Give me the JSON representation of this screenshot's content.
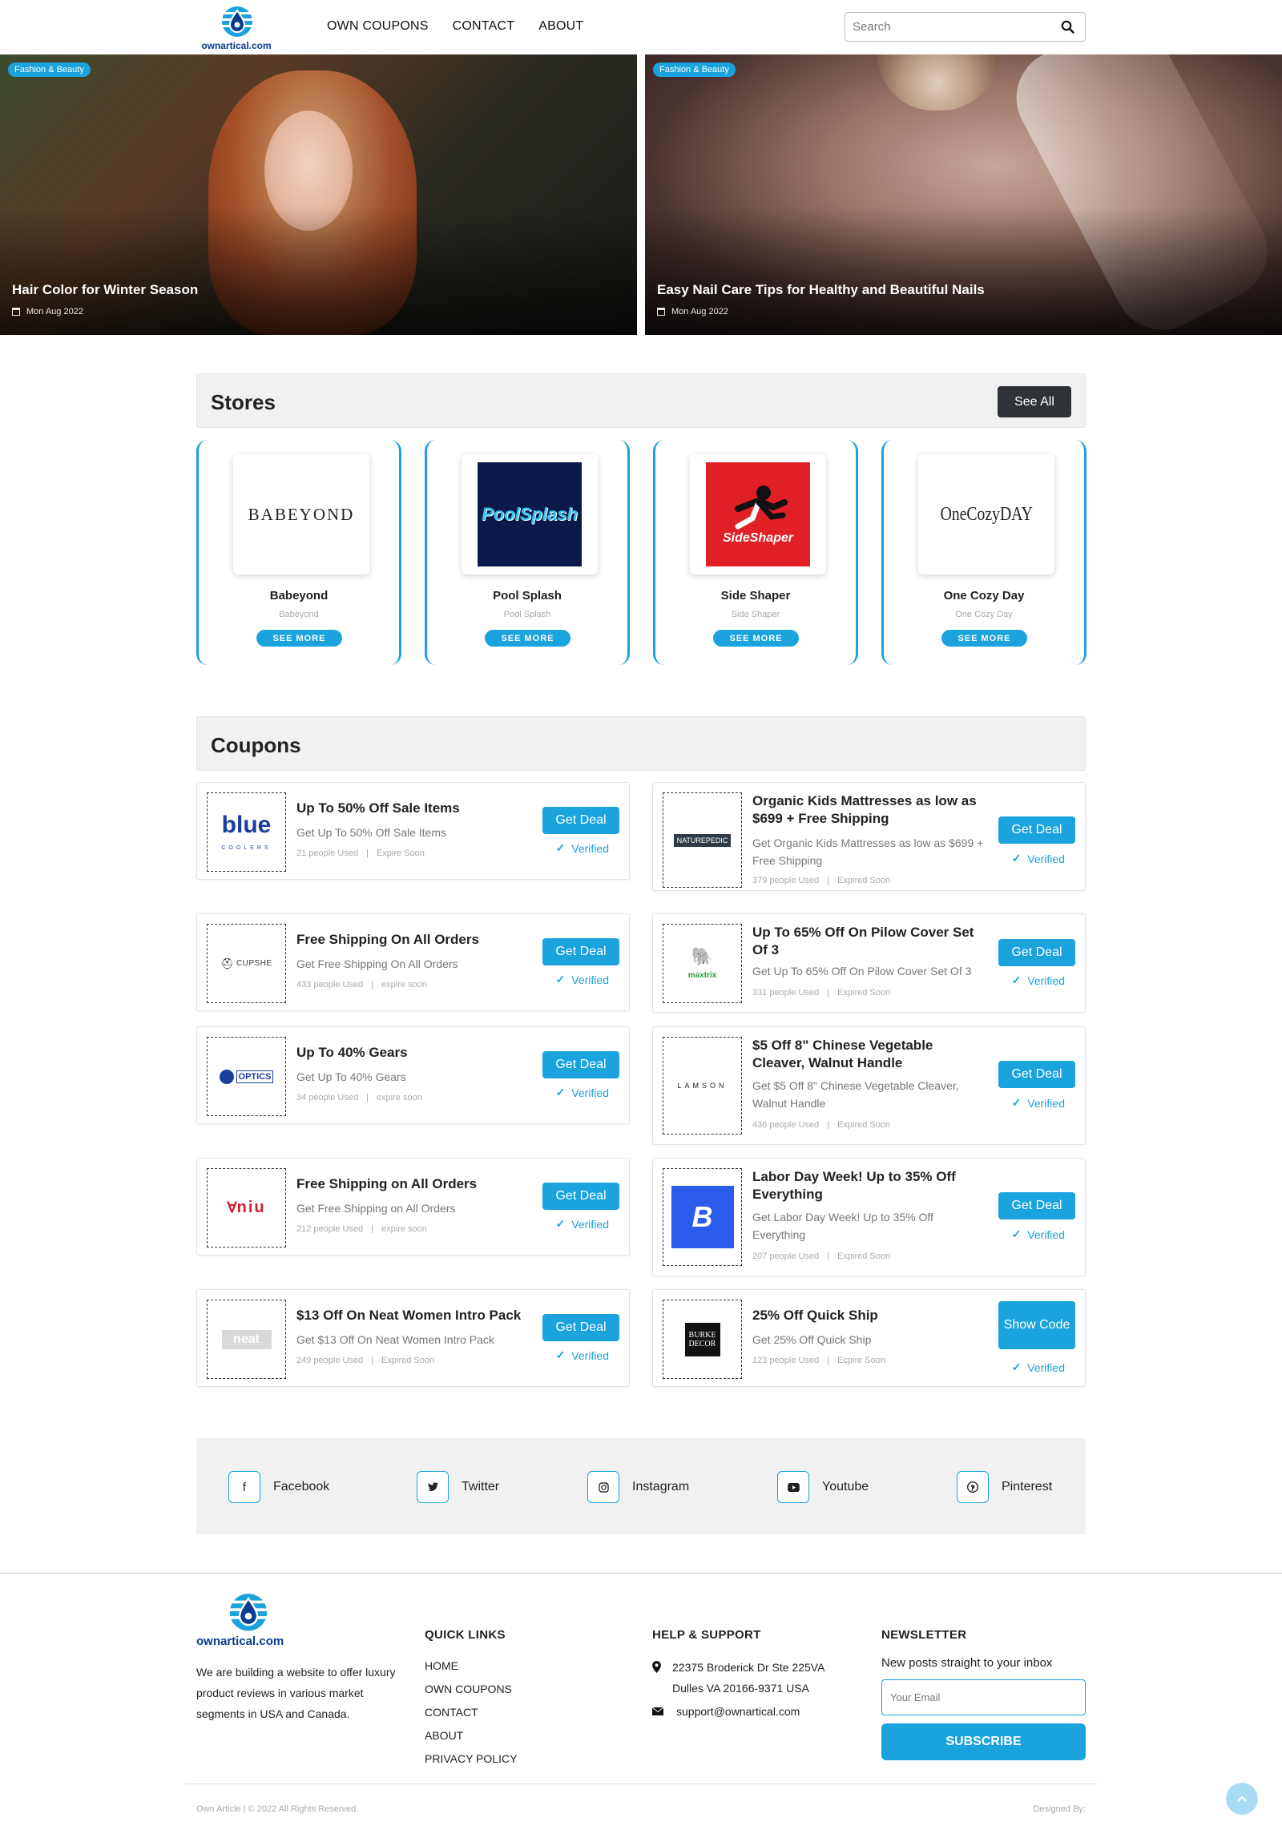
{
  "header": {
    "logo_text": "ownartical.com",
    "nav": [
      "OWN COUPONS",
      "CONTACT",
      "ABOUT"
    ],
    "search_placeholder": "Search"
  },
  "hero": [
    {
      "tag": "Fashion & Beauty",
      "title": "Hair Color for Winter Season",
      "date": "Mon Aug 2022"
    },
    {
      "tag": "Fashion & Beauty",
      "title": "Easy Nail Care Tips for Healthy and Beautiful Nails",
      "date": "Mon Aug 2022"
    }
  ],
  "stores": {
    "title": "Stores",
    "see_all": "See All",
    "items": [
      {
        "logo": "BABEYOND",
        "name": "Babeyond",
        "sub": "Babeyond",
        "button": "SEE MORE"
      },
      {
        "logo": "PoolSplash",
        "name": "Pool Splash",
        "sub": "Pool Splash",
        "button": "SEE MORE"
      },
      {
        "logo": "SideShaper",
        "name": "Side Shaper",
        "sub": "Side Shaper",
        "button": "SEE MORE"
      },
      {
        "logo": "OneCozyDAY",
        "name": "One Cozy Day",
        "sub": "One Cozy Day",
        "button": "SEE MORE"
      }
    ]
  },
  "coupons": {
    "title": "Coupons",
    "items": [
      {
        "logo": "blue",
        "logo_sub": "COOLERS",
        "title": "Up To 50% Off Sale Items",
        "desc": "Get Up To 50% Off Sale Items",
        "used": "21 people Used",
        "expire": "Expire Soon",
        "button": "Get Deal",
        "verified": "Verified"
      },
      {
        "logo": "NATUREPEDIC",
        "title": "Organic Kids Mattresses as low as $699 + Free Shipping",
        "desc": "Get Organic Kids Mattresses as low as $699 + Free Shipping",
        "used": "379 people Used",
        "expire": "Expired Soon",
        "button": "Get Deal",
        "verified": "Verified"
      },
      {
        "logo": "CUPSHE",
        "title": "Free Shipping On All Orders",
        "desc": "Get Free Shipping On All Orders",
        "used": "433 people Used",
        "expire": "expire soon",
        "button": "Get Deal",
        "verified": "Verified"
      },
      {
        "logo": "maxtrix",
        "title": "Up To 65% Off On Pilow Cover Set Of 3",
        "desc": "Get Up To 65% Off On Pilow Cover Set Of 3",
        "used": "331 people Used",
        "expire": "Expired Soon",
        "button": "Get Deal",
        "verified": "Verified"
      },
      {
        "logo": "OPTICS",
        "title": "Up To 40% Gears",
        "desc": "Get Up To 40% Gears",
        "used": "34 people Used",
        "expire": "expire soon",
        "button": "Get Deal",
        "verified": "Verified"
      },
      {
        "logo": "LAMSON",
        "title": "$5 Off 8\" Chinese Vegetable Cleaver, Walnut Handle",
        "desc": "Get $5 Off 8\" Chinese Vegetable Cleaver, Walnut Handle",
        "used": "436 people Used",
        "expire": "Expired Soon",
        "button": "Get Deal",
        "verified": "Verified"
      },
      {
        "logo": "niu",
        "title": "Free Shipping on All Orders",
        "desc": "Get Free Shipping on All Orders",
        "used": "212 people Used",
        "expire": "expire soon",
        "button": "Get Deal",
        "verified": "Verified"
      },
      {
        "logo": "B",
        "title": "Labor Day Week! Up to 35% Off Everything",
        "desc": "Get Labor Day Week! Up to 35% Off Everything",
        "used": "207 people Used",
        "expire": "Expired Soon",
        "button": "Get Deal",
        "verified": "Verified"
      },
      {
        "logo": "neat",
        "title": "$13 Off On Neat Women Intro Pack",
        "desc": "Get $13 Off On Neat Women Intro Pack",
        "used": "249 people Used",
        "expire": "Expired Soon",
        "button": "Get Deal",
        "verified": "Verified"
      },
      {
        "logo": "BURKE DECOR",
        "title": "25% Off Quick Ship",
        "desc": "Get 25% Off Quick Ship",
        "used": "123 people Used",
        "expire": "Ecpire Soon",
        "button": "Show Code",
        "verified": "Verified"
      }
    ]
  },
  "social": [
    {
      "icon": "facebook-icon",
      "glyph": "f",
      "label": "Facebook"
    },
    {
      "icon": "twitter-icon",
      "glyph": "🐦",
      "label": "Twitter"
    },
    {
      "icon": "instagram-icon",
      "glyph": "◎",
      "label": "Instagram"
    },
    {
      "icon": "youtube-icon",
      "glyph": "▶",
      "label": "Youtube"
    },
    {
      "icon": "pinterest-icon",
      "glyph": "℗",
      "label": "Pinterest"
    }
  ],
  "footer": {
    "logo_text": "ownartical.com",
    "about": "We are building a website to offer luxury product reviews in various market segments in USA and Canada.",
    "quick_links_title": "QUICK LINKS",
    "quick_links": [
      "HOME",
      "OWN COUPONS",
      "CONTACT",
      "ABOUT",
      "PRIVACY POLICY"
    ],
    "help_title": "HELP & SUPPORT",
    "address": "22375 Broderick Dr Ste 225VA Dulles VA 20166-9371 USA",
    "email": "support@ownartical.com",
    "newsletter_title": "NEWSLETTER",
    "newsletter_sub": "New posts straight to your inbox",
    "email_placeholder": "Your Email",
    "subscribe": "SUBSCRIBE",
    "copyright": "Own Article | © 2022 All Rights Reserved.",
    "designed_by": "Designed By:"
  },
  "colors": {
    "accent": "#1aa3dd",
    "dark_button": "#2f3338",
    "brand_text": "#0a3d8f"
  }
}
